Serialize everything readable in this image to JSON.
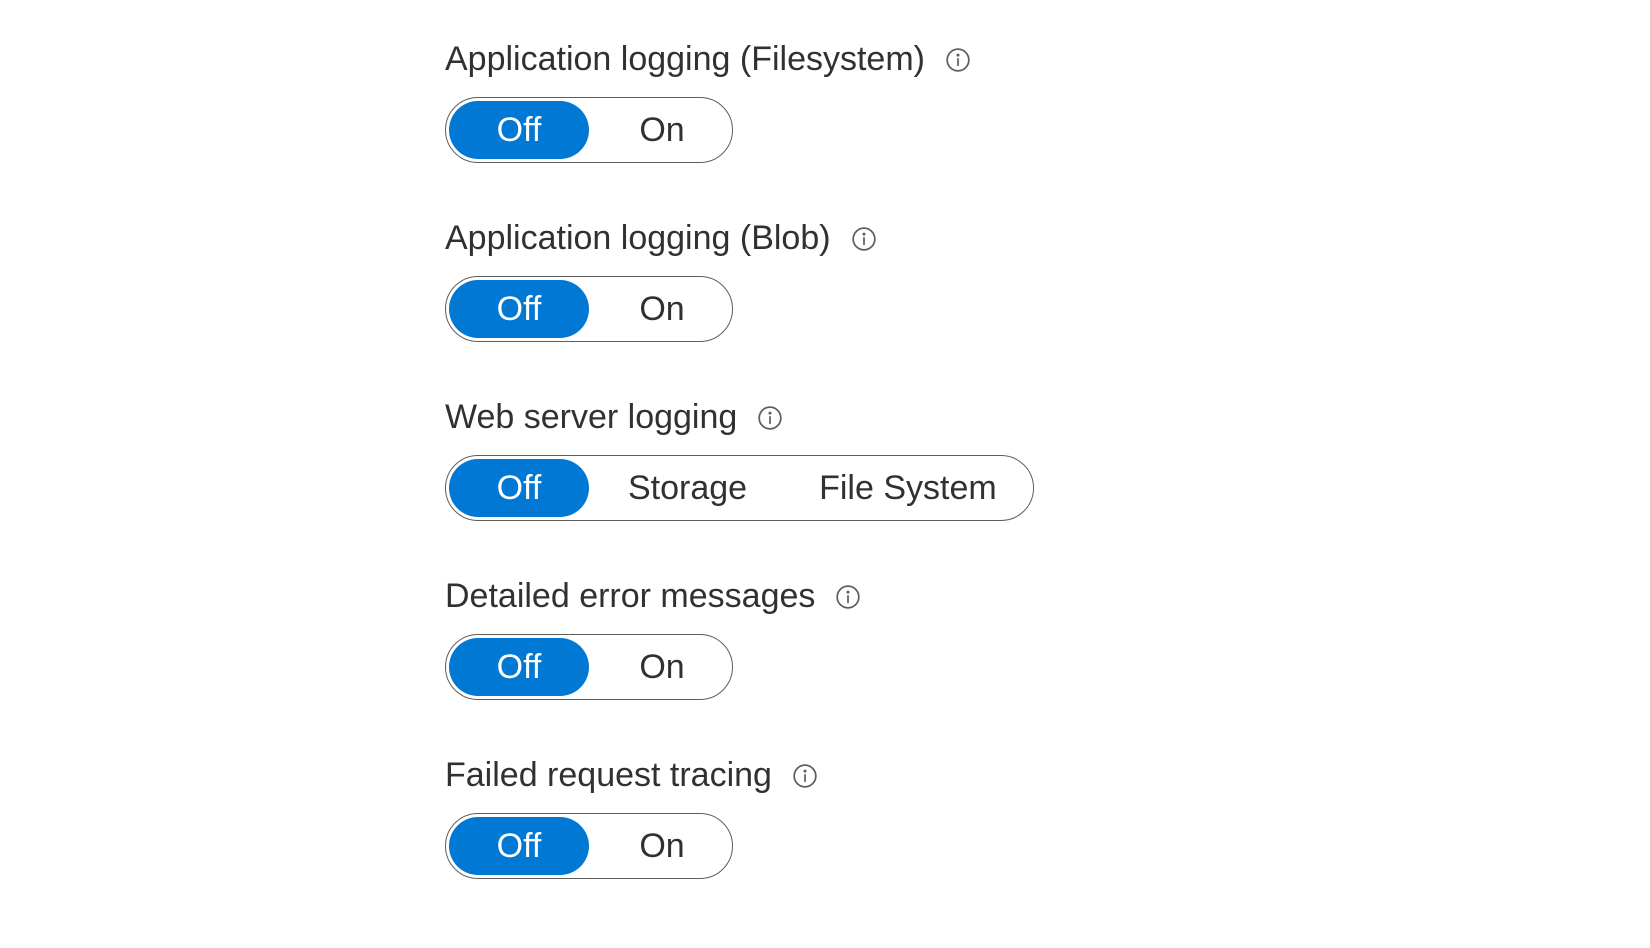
{
  "settings": [
    {
      "id": "app-logging-fs",
      "label": "Application logging (Filesystem)",
      "options": [
        "Off",
        "On"
      ],
      "selected": 0
    },
    {
      "id": "app-logging-blob",
      "label": "Application logging (Blob)",
      "options": [
        "Off",
        "On"
      ],
      "selected": 0
    },
    {
      "id": "web-server-logging",
      "label": "Web server logging",
      "options": [
        "Off",
        "Storage",
        "File System"
      ],
      "selected": 0
    },
    {
      "id": "detailed-error-messages",
      "label": "Detailed error messages",
      "options": [
        "Off",
        "On"
      ],
      "selected": 0
    },
    {
      "id": "failed-request-tracing",
      "label": "Failed request tracing",
      "options": [
        "Off",
        "On"
      ],
      "selected": 0
    }
  ],
  "colors": {
    "accent": "#0078d4",
    "text": "#323130",
    "border": "#605e5c"
  }
}
